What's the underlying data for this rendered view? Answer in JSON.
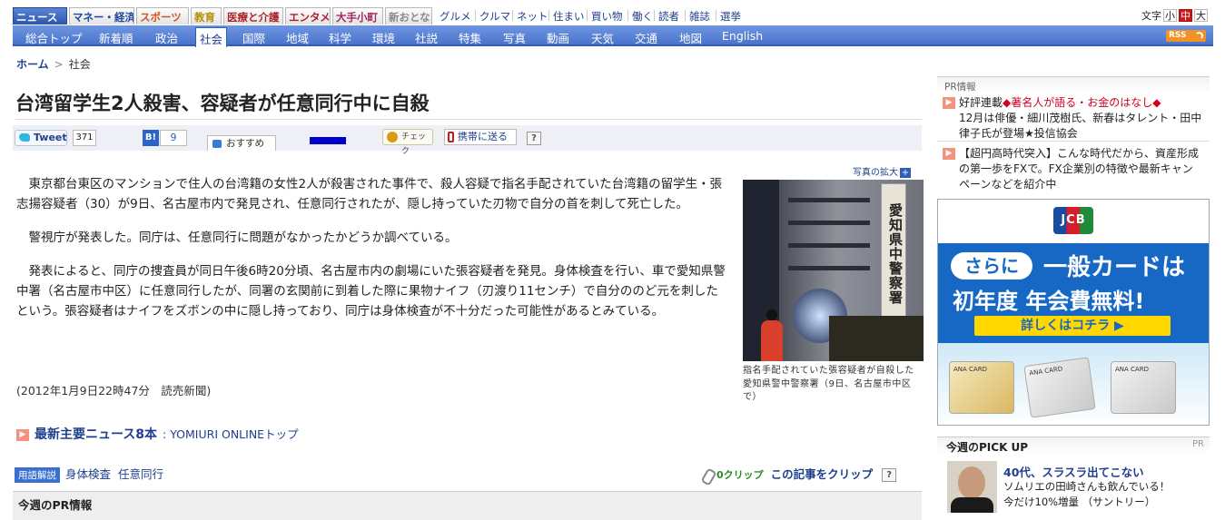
{
  "top_nav": {
    "category_tabs": [
      "ニュース",
      "マネー・経済",
      "スポーツ",
      "教育",
      "医療と介護",
      "エンタメ",
      "大手小町",
      "新おとな"
    ],
    "links": [
      "グルメ",
      "クルマ",
      "ネット",
      "住まい",
      "買い物",
      "働く",
      "読者",
      "雑誌",
      "選挙"
    ],
    "font_size": {
      "label": "文字",
      "small": "小",
      "medium": "中",
      "large": "大"
    }
  },
  "sub_nav": {
    "items": [
      "総合トップ",
      "新着順",
      "政治",
      "社会",
      "国際",
      "地域",
      "科学",
      "環境",
      "社説",
      "特集",
      "写真",
      "動画",
      "天気",
      "交通",
      "地図",
      "English"
    ],
    "active": "社会",
    "rss": "RSS"
  },
  "breadcrumb": {
    "home": "ホーム",
    "sep": ">",
    "current": "社会"
  },
  "headline": "台湾留学生2人殺害、容疑者が任意同行中に自殺",
  "social": {
    "tweet_label": "Tweet",
    "tweet_count": "371",
    "hatena_label": "B!",
    "hatena_count": "9",
    "recommend_label": "おすすめ",
    "check_label": "チェック",
    "mobile_label": "携帯に送る",
    "help": "?"
  },
  "article": {
    "paragraphs": [
      "東京都台東区のマンションで住人の台湾籍の女性2人が殺害された事件で、殺人容疑で指名手配されていた台湾籍の留学生・張志揚容疑者（30）が9日、名古屋市内で発見され、任意同行されたが、隠し持っていた刃物で自分の首を刺して死亡した。",
      "警視庁が発表した。同庁は、任意同行に問題がなかったかどうか調べている。",
      "発表によると、同庁の捜査員が同日午後6時20分頃、名古屋市内の劇場にいた張容疑者を発見。身体検査を行い、車で愛知県警中署（名古屋市中区）に任意同行したが、同署の玄関前に到着した際に果物ナイフ（刃渡り11センチ）で自分ののど元を刺したという。張容疑者はナイフをズボンの中に隠し持っており、同庁は身体検査が不十分だった可能性があるとみている。"
    ],
    "dateline": "(2012年1月9日22時47分　読売新聞)"
  },
  "photo": {
    "enlarge_label": "写真の拡大",
    "enlarge_icon": "+",
    "sign_text": "愛知県中警察署",
    "caption": "指名手配されていた張容疑者が自殺した愛知県警中警察署（9日、名古屋市中区で）"
  },
  "latest": {
    "icon": "▶",
    "title": "最新主要ニュース8本",
    "link": ": YOMIURI ONLINEトップ"
  },
  "terms": {
    "label": "用語解説",
    "items": [
      "身体検査",
      "任意同行"
    ]
  },
  "clip": {
    "count": "0クリップ",
    "label": "この記事をクリップ",
    "help": "?"
  },
  "pr_section_title": "今週のPR情報",
  "sidebar": {
    "pr_label": "PR情報",
    "pr_items": [
      {
        "prefix": "好評連載",
        "highlight": "◆著名人が語る・お金のはなし◆",
        "rest_lines": [
          "12月は俳優・細川茂樹氏、新春はタレント・田中",
          "律子氏が登場★投信協会"
        ]
      },
      {
        "lines": [
          "【超円高時代突入】こんな時代だから、資産形成",
          "の第一歩をFXで。FX企業別の特徴や最新キャン",
          "ペーンなどを紹介中"
        ]
      }
    ],
    "ad": {
      "brand": "JCB",
      "badge": "さらに",
      "line1": "一般カードは",
      "line2": "初年度 年会費無料!",
      "cta": "詳しくはコチラ ▶",
      "card_texts": [
        "ANA CARD",
        "ANA CARD",
        "ANA CARD"
      ]
    },
    "pickup": {
      "title": "今週のPICK UP",
      "pr": "PR",
      "headline": "40代、スラスラ出てこない",
      "desc_lines": [
        "ソムリエの田崎さんも飲んでいる！",
        "今だけ10%増量 （サントリー）"
      ]
    }
  },
  "colors": {
    "nav_blue": "#4a74cc",
    "link": "#1f3f8e",
    "accent_red": "#c8191f",
    "pr_red": "#d1001f"
  }
}
